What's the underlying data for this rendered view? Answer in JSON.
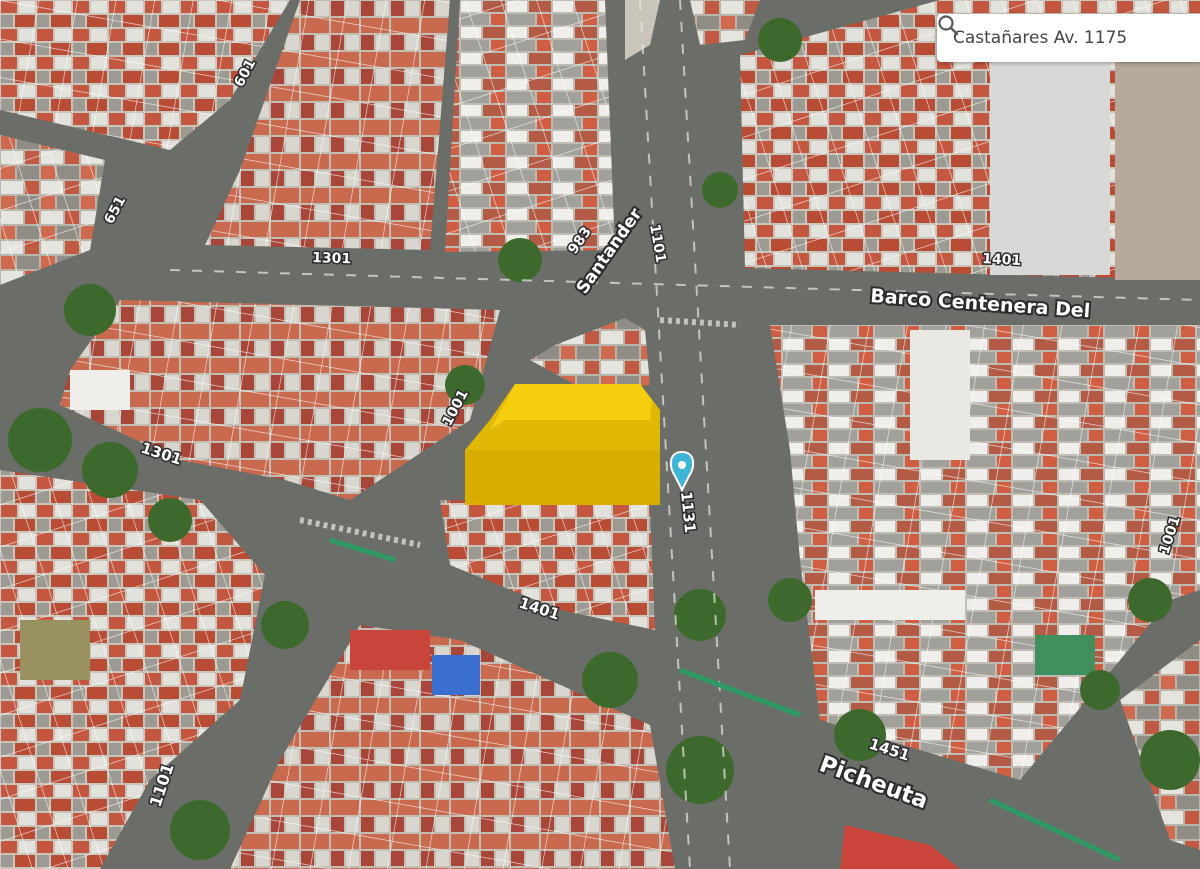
{
  "search": {
    "value": "Castañares Av. 1175",
    "icon": "search-icon"
  },
  "streets": {
    "barco_centenera": "Barco Centenera Del",
    "santander": "Santander",
    "picheuta": "Picheuta"
  },
  "block_numbers": {
    "n601": "601",
    "n651": "651",
    "n1101_top": "1101",
    "n983": "983",
    "n1301_top": "1301",
    "n1401_top": "1401",
    "n1001": "1001",
    "n1301_left": "1301",
    "n1131": "1131",
    "n1401_mid": "1401",
    "n1451": "1451",
    "n1101_bottom": "1101",
    "n1001_right": "1001"
  },
  "marker": {
    "icon": "map-pin-icon",
    "color": "#3fb5d6"
  },
  "highlight": {
    "color": "#f2c300",
    "label": "selected-lot-volume"
  },
  "colors": {
    "road": "#6b6d68",
    "block_ground": "#bdbab0",
    "roof_red": "#c4573f",
    "roof_white": "#e4e2dc",
    "tree": "#3f6a2e",
    "parcel_line": "#ffffff"
  }
}
